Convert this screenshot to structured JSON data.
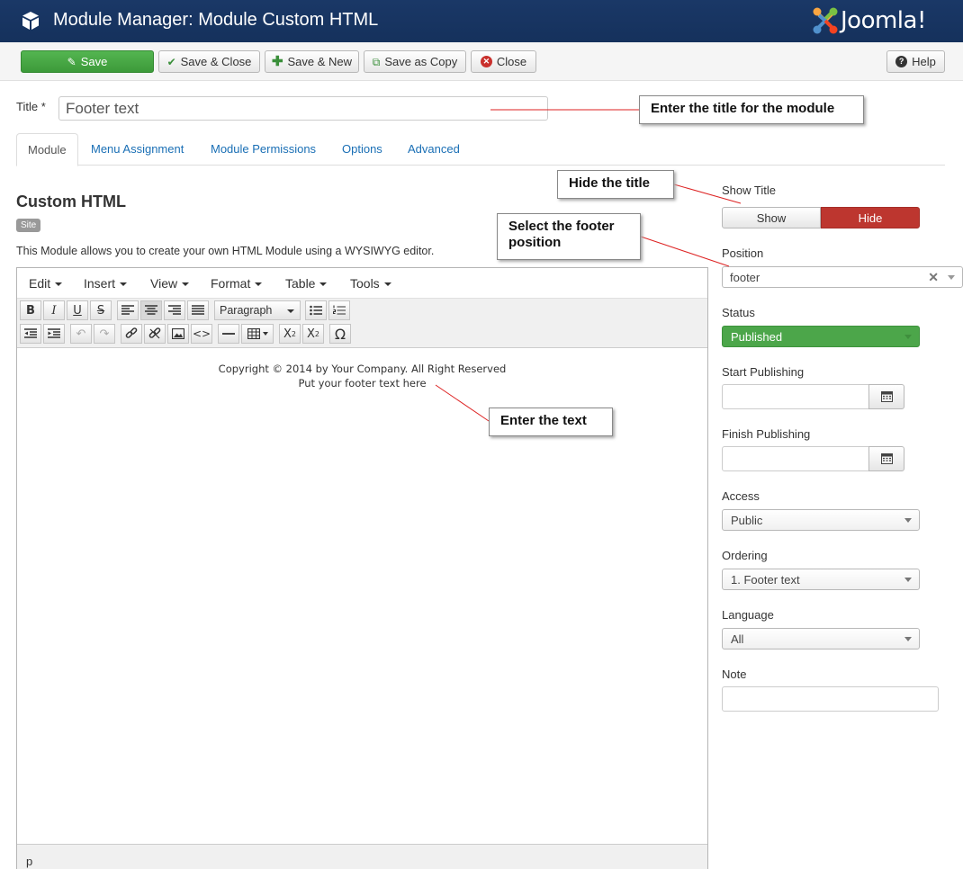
{
  "header": {
    "title": "Module Manager: Module Custom HTML",
    "logo_text": "Joomla!"
  },
  "toolbar": {
    "save": "Save",
    "save_close": "Save & Close",
    "save_new": "Save & New",
    "save_copy": "Save as Copy",
    "close": "Close",
    "help": "Help"
  },
  "title_field": {
    "label": "Title *",
    "value": "Footer text"
  },
  "tabs": [
    "Module",
    "Menu Assignment",
    "Module Permissions",
    "Options",
    "Advanced"
  ],
  "main": {
    "heading": "Custom HTML",
    "badge": "Site",
    "description": "This Module allows you to create your own HTML Module using a WYSIWYG editor."
  },
  "editor": {
    "menus": [
      "Edit",
      "Insert",
      "View",
      "Format",
      "Table",
      "Tools"
    ],
    "block_format": "Paragraph",
    "content_lines": [
      "Copyright © 2014 by Your Company. All Right Reserved",
      "Put your footer text here"
    ],
    "status_path": "p"
  },
  "callouts": {
    "title": "Enter the title for the module",
    "hide_title": "Hide the title",
    "footer_position": "Select the footer position",
    "text": "Enter the text"
  },
  "sidebar": {
    "show_title_label": "Show Title",
    "show": "Show",
    "hide": "Hide",
    "position_label": "Position",
    "position_value": "footer",
    "status_label": "Status",
    "status_value": "Published",
    "start_label": "Start Publishing",
    "finish_label": "Finish Publishing",
    "access_label": "Access",
    "access_value": "Public",
    "ordering_label": "Ordering",
    "ordering_value": "1. Footer text",
    "language_label": "Language",
    "language_value": "All",
    "note_label": "Note"
  },
  "colors": {
    "header": "#1a3867",
    "save_green": "#46a546",
    "hide_red": "#bd362f",
    "link_blue": "#1a6fb5"
  },
  "icons": [
    "cube-icon",
    "joomla-logo-icon",
    "edit-icon",
    "check-icon",
    "plus-icon",
    "copy-icon",
    "close-circle-icon",
    "question-icon",
    "calendar-icon"
  ]
}
